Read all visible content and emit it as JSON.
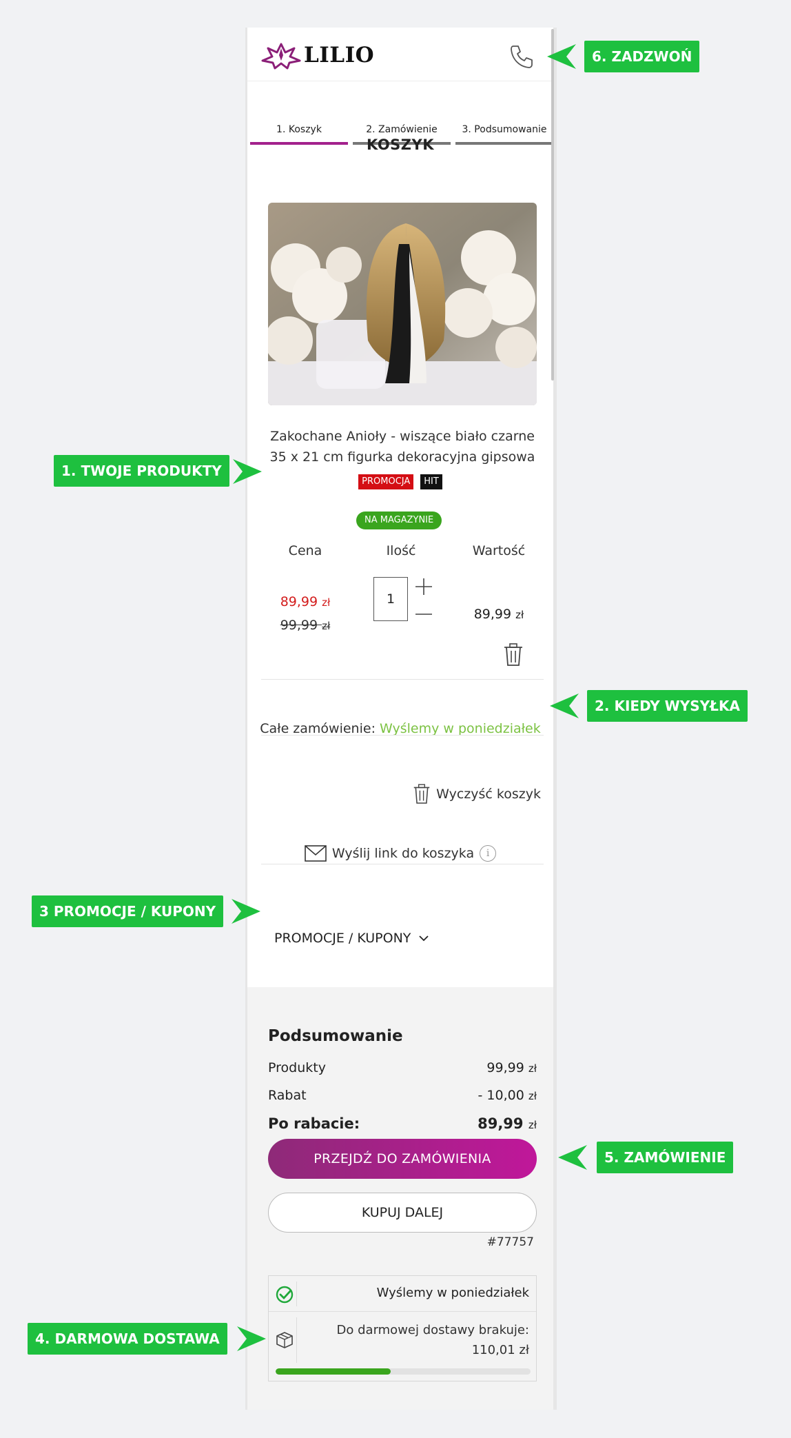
{
  "brand": {
    "name": "LILIO",
    "accent": "#a3218d"
  },
  "header": {
    "call_icon": "phone-icon"
  },
  "steps": [
    {
      "label": "1. Koszyk",
      "active": true
    },
    {
      "label": "2. Zamówienie",
      "active": false
    },
    {
      "label": "3. Podsumowanie",
      "active": false
    }
  ],
  "cart": {
    "title": "KOSZYK",
    "product": {
      "name_line1": "Zakochane Anioły - wiszące biało czarne",
      "name_line2": "35 x 21 cm figurka dekoracyjna gipsowa",
      "badges": [
        "PROMOCJA",
        "HIT"
      ],
      "stock": "NA MAGAZYNIE",
      "columns": [
        "Cena",
        "Ilość",
        "Wartość"
      ],
      "price_new": "89,99",
      "price_old": "99,99",
      "currency": "zł",
      "quantity": "1",
      "value": "89,99"
    },
    "shipping_label": "Całe zamówienie:",
    "shipping_value": "Wyślemy w poniedziałek",
    "clear_cart": "Wyczyść koszyk",
    "send_link": "Wyślij link do koszyka",
    "info": "i",
    "promo_toggle": "PROMOCJE / KUPONY"
  },
  "summary": {
    "title": "Podsumowanie",
    "rows": [
      {
        "label": "Produkty",
        "value": "99,99",
        "currency": "zł"
      },
      {
        "label": "Rabat",
        "value": "- 10,00",
        "currency": "zł"
      },
      {
        "label": "Po rabacie:",
        "value": "89,99",
        "currency": "zł"
      }
    ],
    "checkout_button": "PRZEJDŹ DO ZAMÓWIENIA",
    "continue_button": "KUPUJ DALEJ",
    "cart_id": "#77757",
    "ship_when": "Wyślemy w poniedziałek",
    "free_shipping_label": "Do darmowej dostawy brakuje:",
    "free_shipping_missing": "110,01 zł",
    "free_shipping_progress": 0.45
  },
  "callouts": {
    "call": "6. ZADZWOŃ",
    "products": "1. TWOJE PRODUKTY",
    "shipping": "2. KIEDY WYSYŁKA",
    "promo": "3 PROMOCJE / KUPONY",
    "order": "5. ZAMÓWIENIE",
    "free_delivery": "4. DARMOWA DOSTAWA"
  },
  "colors": {
    "callout_green": "#1ec03f",
    "price_red": "#d31c1c",
    "ship_green": "#7cc243",
    "stock_green": "#3aa51e"
  }
}
